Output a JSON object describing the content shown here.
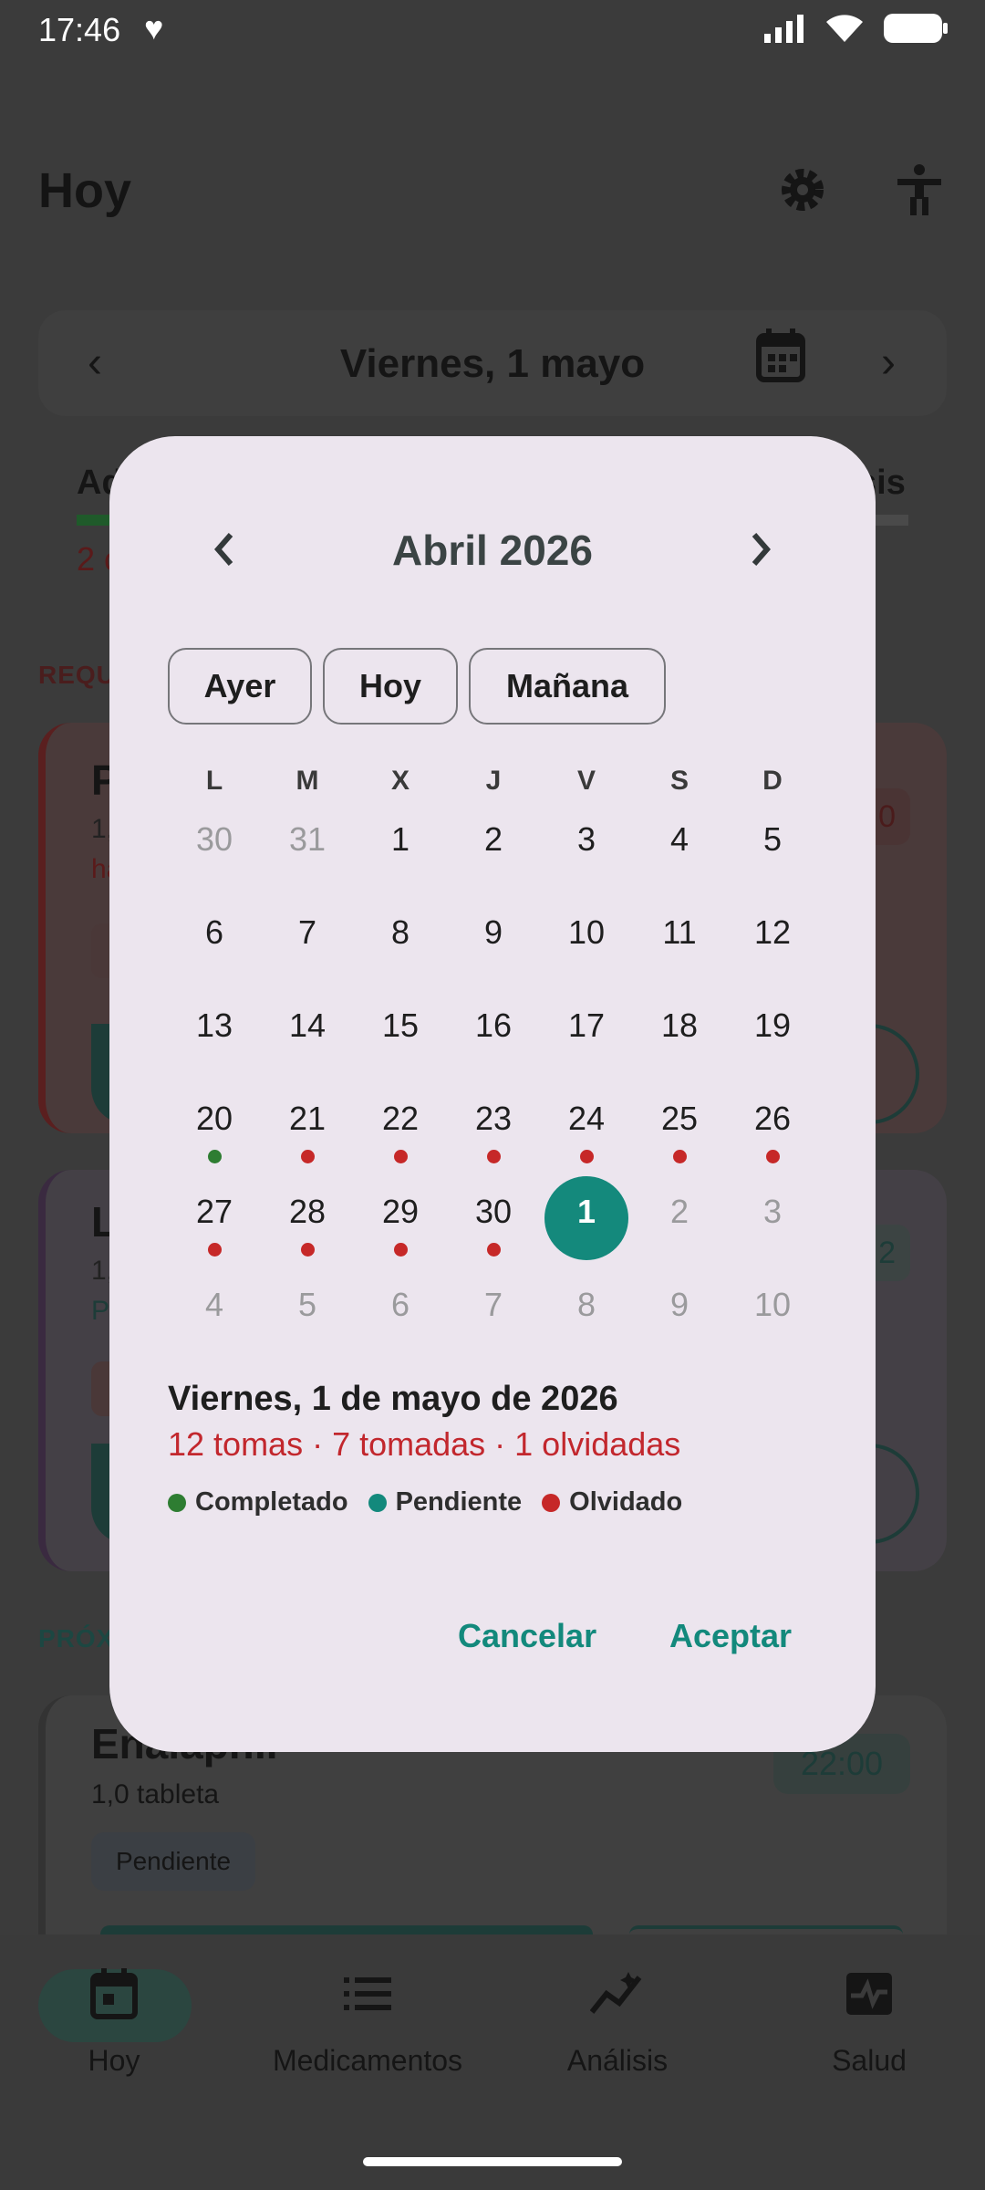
{
  "status_bar": {
    "time": "17:46"
  },
  "app": {
    "title": "Hoy",
    "date_label": "Viernes, 1 mayo",
    "section_required": "REQU",
    "section_next": "PRÓX",
    "cards": [
      {
        "title": "P",
        "sub1": "1,",
        "sub2": "ha",
        "badge": "0"
      },
      {
        "title": "L",
        "sub1": "1,",
        "sub2": "P",
        "badge": "2"
      },
      {
        "title": "Enalapr...",
        "sub1": "1,0 tableta",
        "chip": "Pendiente",
        "time": "22:00"
      }
    ],
    "tab_left": "Ad",
    "tab_left_sub": "2 c",
    "tab_right": "sis"
  },
  "nav": {
    "items": [
      {
        "label": "Hoy",
        "icon": "calendar-icon"
      },
      {
        "label": "Medicamentos",
        "icon": "list-icon"
      },
      {
        "label": "Análisis",
        "icon": "analytics-icon"
      },
      {
        "label": "Salud",
        "icon": "health-icon"
      }
    ]
  },
  "dialog": {
    "month": "Abril 2026",
    "quick": [
      "Ayer",
      "Hoy",
      "Mañana"
    ],
    "weekdays": [
      "L",
      "M",
      "X",
      "J",
      "V",
      "S",
      "D"
    ],
    "weeks": [
      [
        {
          "d": "30",
          "m": true
        },
        {
          "d": "31",
          "m": true
        },
        {
          "d": "1"
        },
        {
          "d": "2"
        },
        {
          "d": "3"
        },
        {
          "d": "4"
        },
        {
          "d": "5"
        }
      ],
      [
        {
          "d": "6"
        },
        {
          "d": "7"
        },
        {
          "d": "8"
        },
        {
          "d": "9"
        },
        {
          "d": "10"
        },
        {
          "d": "11"
        },
        {
          "d": "12"
        }
      ],
      [
        {
          "d": "13"
        },
        {
          "d": "14"
        },
        {
          "d": "15"
        },
        {
          "d": "16"
        },
        {
          "d": "17"
        },
        {
          "d": "18"
        },
        {
          "d": "19"
        }
      ],
      [
        {
          "d": "20",
          "dot": "completed"
        },
        {
          "d": "21",
          "dot": "missed"
        },
        {
          "d": "22",
          "dot": "missed"
        },
        {
          "d": "23",
          "dot": "missed"
        },
        {
          "d": "24",
          "dot": "missed"
        },
        {
          "d": "25",
          "dot": "missed"
        },
        {
          "d": "26",
          "dot": "missed"
        }
      ],
      [
        {
          "d": "27",
          "dot": "missed"
        },
        {
          "d": "28",
          "dot": "missed"
        },
        {
          "d": "29",
          "dot": "missed"
        },
        {
          "d": "30",
          "dot": "missed"
        },
        {
          "d": "1",
          "sel": true
        },
        {
          "d": "2",
          "m": true
        },
        {
          "d": "3",
          "m": true
        }
      ],
      [
        {
          "d": "4",
          "m": true
        },
        {
          "d": "5",
          "m": true
        },
        {
          "d": "6",
          "m": true
        },
        {
          "d": "7",
          "m": true
        },
        {
          "d": "8",
          "m": true
        },
        {
          "d": "9",
          "m": true
        },
        {
          "d": "10",
          "m": true
        }
      ]
    ],
    "selected_date": "Viernes, 1 de mayo de 2026",
    "summary": "12 tomas · 7 tomadas · 1 olvidadas",
    "legend": [
      {
        "label": "Completado",
        "color": "#2e7d32"
      },
      {
        "label": "Pendiente",
        "color": "#13897c"
      },
      {
        "label": "Olvidado",
        "color": "#c62828"
      }
    ],
    "cancel": "Cancelar",
    "accept": "Aceptar"
  },
  "colors": {
    "accent": "#13897c",
    "completed": "#2e7d32",
    "missed": "#c62828",
    "dialog_bg": "#ece5ee"
  }
}
